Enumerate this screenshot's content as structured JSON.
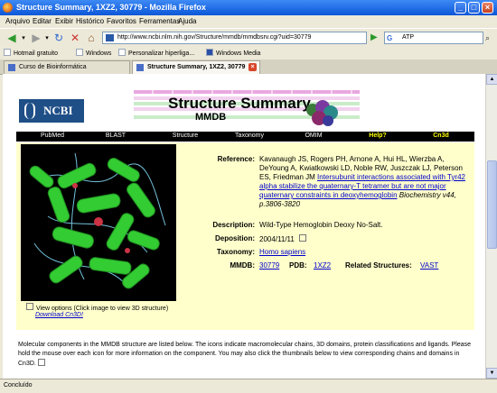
{
  "window": {
    "title": "Structure Summary, 1XZ2, 30779 - Mozilla Firefox"
  },
  "menu": [
    "Arquivo",
    "Editar",
    "Exibir",
    "Histórico",
    "Favoritos",
    "Ferramentas",
    "Ajuda"
  ],
  "nav": {
    "url": "http://www.ncbi.nlm.nih.gov/Structure/mmdb/mmdbsrv.cgi?uid=30779",
    "search_value": "ATP",
    "search_engine": "G"
  },
  "bookmarks": [
    "Hotmail gratuito",
    "Windows",
    "Personalizar hiperliga...",
    "Windows Media"
  ],
  "tabs": [
    {
      "label": "Curso de Bioinformática",
      "active": false
    },
    {
      "label": "Structure Summary, 1XZ2, 30779",
      "active": true
    }
  ],
  "page": {
    "logo": "NCBI",
    "banner_title": "Structure Summary",
    "banner_subtitle": "MMDB",
    "nav_links": [
      "PubMed",
      "BLAST",
      "Structure",
      "Taxonomy",
      "OMIM",
      "Help?",
      "Cn3d"
    ],
    "view_options": "View options (Click image to view 3D structure)",
    "download": "Download Cn3D!",
    "reference_label": "Reference:",
    "reference_authors": "Kavanaugh JS, Rogers PH, Arnone A, Hui HL, Wierzba A, DeYoung A, Kwiatkowski LD, Noble RW, Juszczak LJ, Peterson ES, Friedman JM",
    "reference_title": "Intersubunit interactions associated with Tyr42 alpha stabilize the quaternary-T tetramer but are not major quaternary constraints in deoxyhemoglobin",
    "reference_journal": "Biochemistry v44, p.3806-3820",
    "description_label": "Description:",
    "description": "Wild-Type Hemoglobin Deoxy No-Salt.",
    "deposition_label": "Deposition:",
    "deposition": "2004/11/11",
    "taxonomy_label": "Taxonomy:",
    "taxonomy": "Homo sapiens",
    "mmdb_label": "MMDB:",
    "mmdb": "30779",
    "pdb_label": "PDB:",
    "pdb": "1XZ2",
    "related_label": "Related Structures:",
    "related": "VAST",
    "intro_text": "Molecular components in the MMDB structure are listed below. The icons indicate macromolecular chains, 3D domains, protein classifications and ligands. Please hold the mouse over each icon for more information on the component. You may also click the thumbnails below to view corresponding chains and domains in Cn3D."
  },
  "status": "Concluído",
  "colors": {
    "panel": "#ffffcc",
    "link": "#0000cc",
    "help_link": "#ffff00",
    "structure_green": "#33cc33"
  }
}
